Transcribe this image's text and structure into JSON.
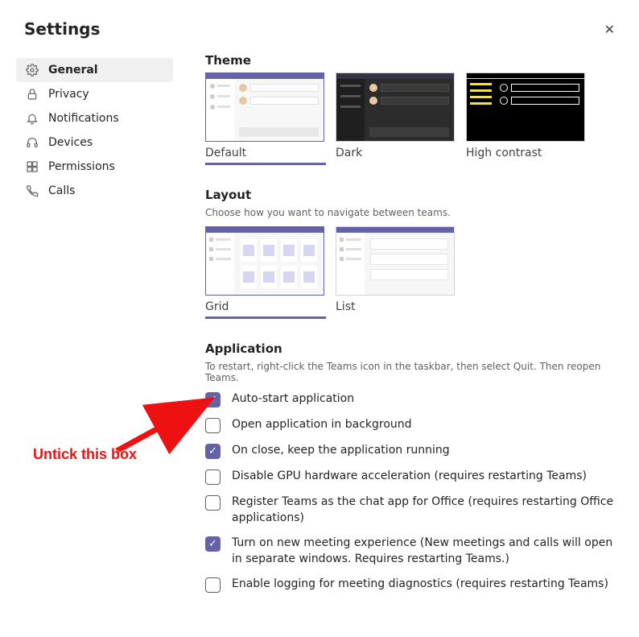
{
  "header": {
    "title": "Settings"
  },
  "sidebar": {
    "items": [
      {
        "label": "General"
      },
      {
        "label": "Privacy"
      },
      {
        "label": "Notifications"
      },
      {
        "label": "Devices"
      },
      {
        "label": "Permissions"
      },
      {
        "label": "Calls"
      }
    ]
  },
  "theme": {
    "heading": "Theme",
    "options": [
      {
        "label": "Default"
      },
      {
        "label": "Dark"
      },
      {
        "label": "High contrast"
      }
    ]
  },
  "layout": {
    "heading": "Layout",
    "desc": "Choose how you want to navigate between teams.",
    "options": [
      {
        "label": "Grid"
      },
      {
        "label": "List"
      }
    ]
  },
  "application": {
    "heading": "Application",
    "desc": "To restart, right-click the Teams icon in the taskbar, then select Quit. Then reopen Teams.",
    "checks": [
      {
        "checked": true,
        "label": "Auto-start application"
      },
      {
        "checked": false,
        "label": "Open application in background"
      },
      {
        "checked": true,
        "label": "On close, keep the application running"
      },
      {
        "checked": false,
        "label": "Disable GPU hardware acceleration (requires restarting Teams)"
      },
      {
        "checked": false,
        "label": "Register Teams as the chat app for Office (requires restarting Office applications)"
      },
      {
        "checked": true,
        "label": "Turn on new meeting experience (New meetings and calls will open in separate windows. Requires restarting Teams.)"
      },
      {
        "checked": false,
        "label": "Enable logging for meeting diagnostics (requires restarting Teams)"
      }
    ]
  },
  "annotation": {
    "text": "Untick this box"
  }
}
